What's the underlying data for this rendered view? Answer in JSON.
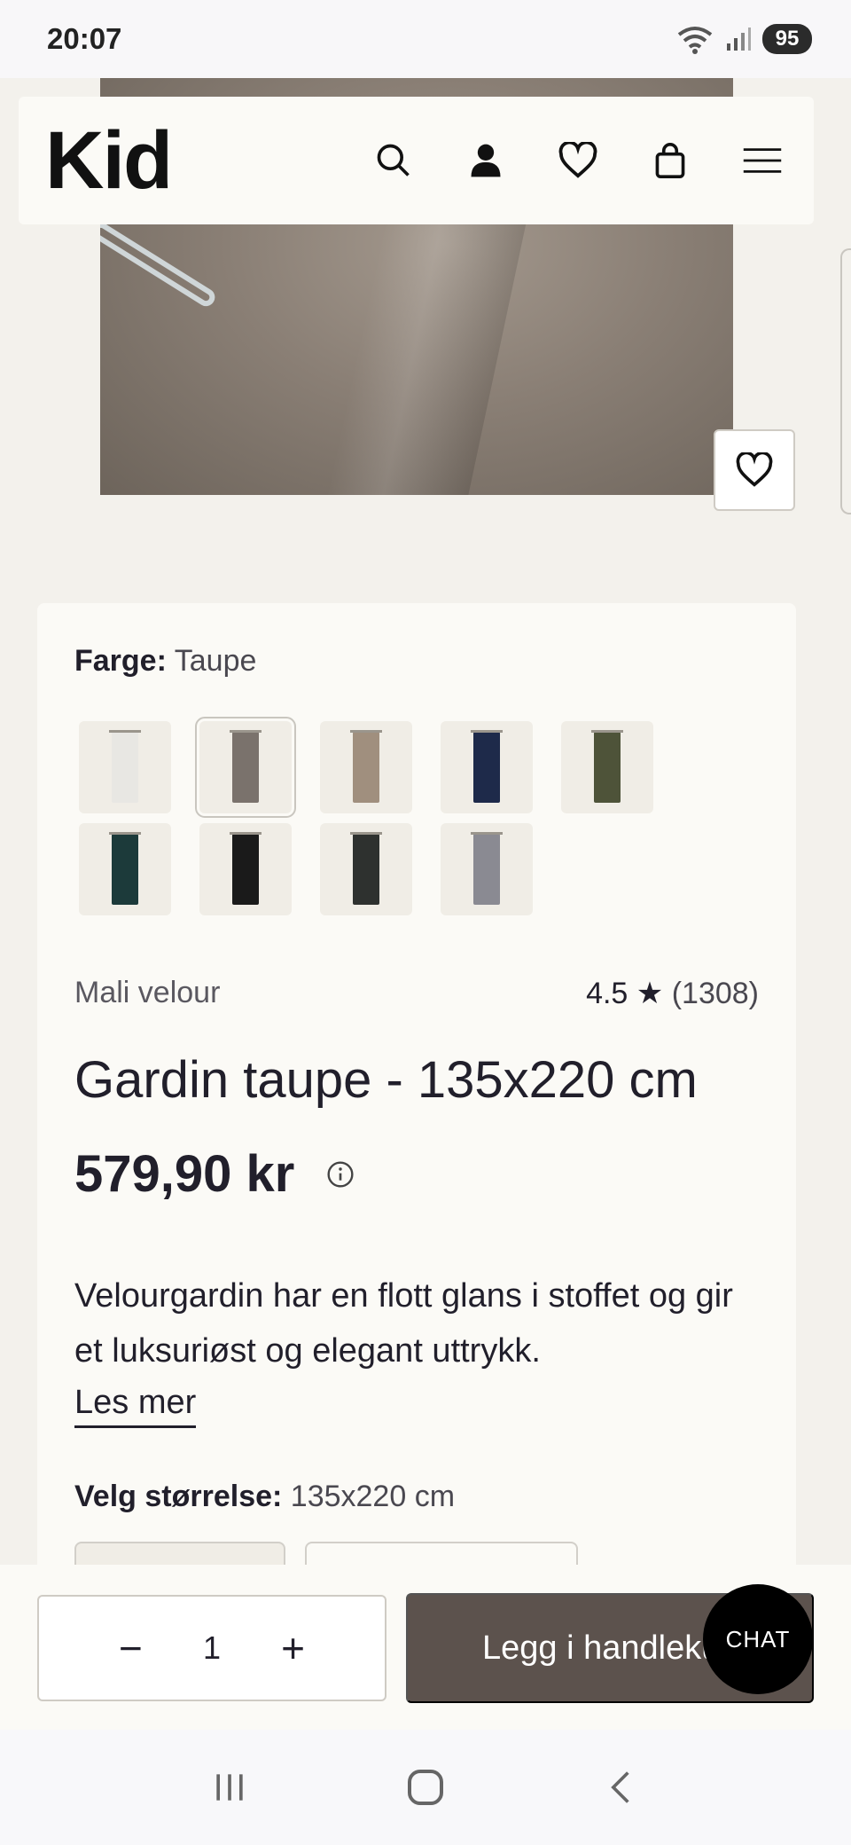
{
  "status_bar": {
    "time": "20:07",
    "battery": "95"
  },
  "header": {
    "logo": "Kid"
  },
  "product": {
    "color_label": "Farge:",
    "color_value": "Taupe",
    "swatches": [
      {
        "color": "#e8e7e3"
      },
      {
        "color": "#7a726c"
      },
      {
        "color": "#a08f7e"
      },
      {
        "color": "#1e2a4a"
      },
      {
        "color": "#4e5339"
      },
      {
        "color": "#1c3a3a"
      },
      {
        "color": "#1a1a1a"
      },
      {
        "color": "#2e312f"
      },
      {
        "color": "#8a8a92"
      }
    ],
    "brand": "Mali velour",
    "rating": "4.5",
    "rating_star": "★",
    "review_count": "(1308)",
    "title": "Gardin taupe - 135x220 cm",
    "price": "579,90 kr",
    "description": "Velourgardin har en flott glans i stoffet og gir et luksuriøst og elegant uttrykk.",
    "read_more": "Les mer",
    "size_label": "Velg størrelse:",
    "size_value": "135x220 cm"
  },
  "buybar": {
    "minus": "−",
    "quantity": "1",
    "plus": "+",
    "add_to_cart": "Legg i handlekurv"
  },
  "chat": {
    "label": "CHAT"
  },
  "colors": {
    "accent": "#5c524d",
    "background": "#f3f1ec",
    "card": "#fbfaf6"
  }
}
